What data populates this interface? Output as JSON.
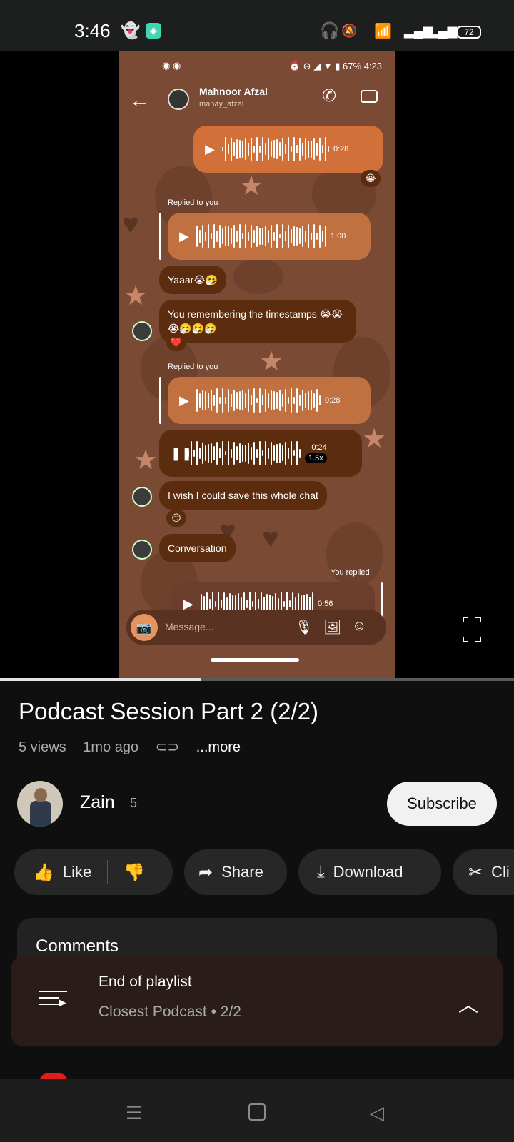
{
  "status_bar": {
    "time": "3:46",
    "battery": "72"
  },
  "video": {
    "ig_status": {
      "time": "4:23",
      "battery": "67%"
    },
    "ig_header": {
      "name": "Mahnoor Afzal",
      "handle": "manay_afzal"
    },
    "messages": {
      "voice1_duration": "0:28",
      "reply1_label": "Replied to you",
      "voice2_duration": "1:00",
      "text1": "Yaaar😭🤧",
      "text2": "You remembering the timestamps 😭😭😭🤧🤧🤧",
      "reply2_label": "Replied to you",
      "voice3_duration": "0:28",
      "voice4_duration": "0:24",
      "voice4_speed": "1.5x",
      "text3": "I wish I could save this whole chat",
      "text4": "Conversation",
      "you_replied": "You replied",
      "voice5_duration": "0:56",
      "reaction1": "😭",
      "reaction2": "❤️",
      "reaction3": "😏"
    },
    "message_placeholder": "Message...",
    "progress": 0.39
  },
  "details": {
    "title": "Podcast Session Part 2 (2/2)",
    "views": "5 views",
    "age": "1mo ago",
    "more": "...more",
    "channel_name": "Zain",
    "subscriber_count": "5",
    "subscribe_label": "Subscribe"
  },
  "actions": {
    "like": "Like",
    "share": "Share",
    "download": "Download",
    "clip": "Cli"
  },
  "comments": {
    "title": "Comments"
  },
  "playlist": {
    "title": "End of playlist",
    "subtitle": "Closest Podcast • 2/2"
  },
  "colors": {
    "accent_brown": "#7a4a34",
    "bubble": "#5c2c0e",
    "voice_orange": "#d2703a"
  }
}
